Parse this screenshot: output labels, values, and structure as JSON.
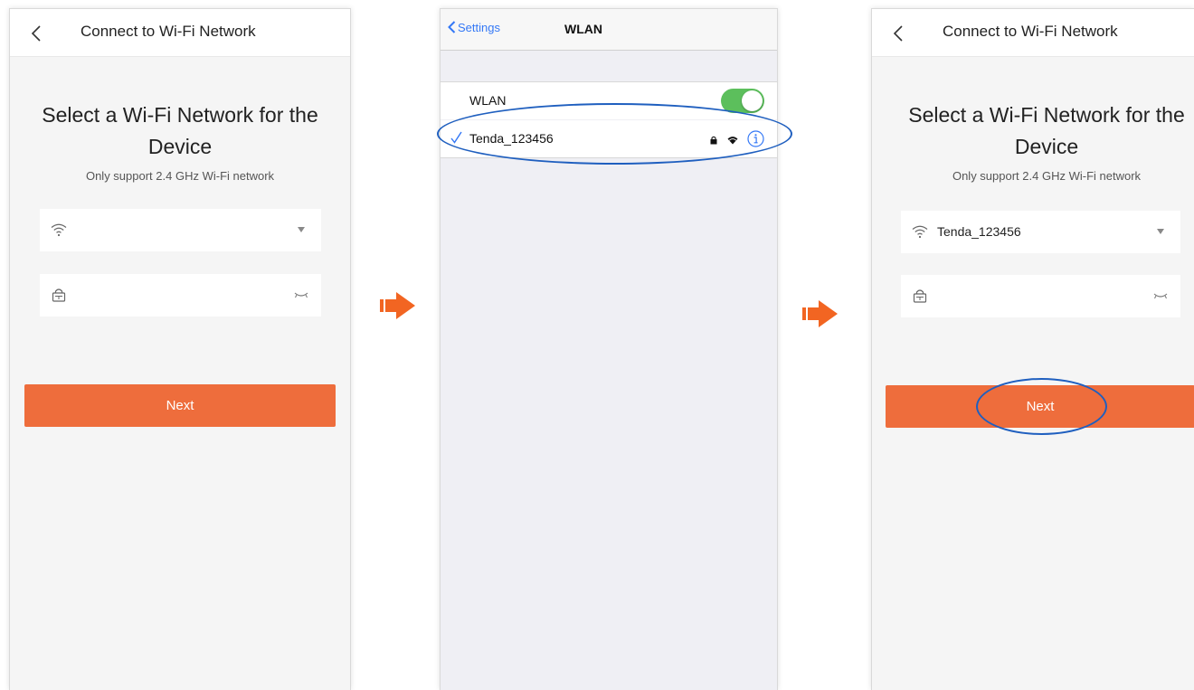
{
  "panel_left": {
    "header_title": "Connect to Wi-Fi Network",
    "heading": "Select a Wi-Fi Network for the Device",
    "subtext": "Only support 2.4 GHz Wi-Fi network",
    "ssid_value": "",
    "password_value": "",
    "next_label": "Next"
  },
  "panel_middle": {
    "back_label": "Settings",
    "title": "WLAN",
    "wlan_label": "WLAN",
    "wlan_enabled": true,
    "network_name": "Tenda_123456",
    "network_secured": true
  },
  "panel_right": {
    "header_title": "Connect to Wi-Fi Network",
    "heading": "Select a Wi-Fi Network for the Device",
    "subtext": "Only support 2.4 GHz Wi-Fi network",
    "ssid_value": "Tenda_123456",
    "password_value": "",
    "next_label": "Next"
  },
  "colors": {
    "accent": "#ee6d3c",
    "highlight": "#1f5fbf",
    "ios_blue": "#3478f6",
    "toggle_on": "#5cbf5c"
  },
  "icons": {
    "back": "chevron-left-icon",
    "wifi": "wifi-icon",
    "lock": "lock-icon",
    "dropdown": "caret-down-icon",
    "password_visibility": "eye-closed-icon",
    "step_arrow": "arrow-right-icon",
    "info": "info-icon",
    "check": "checkmark-icon"
  }
}
